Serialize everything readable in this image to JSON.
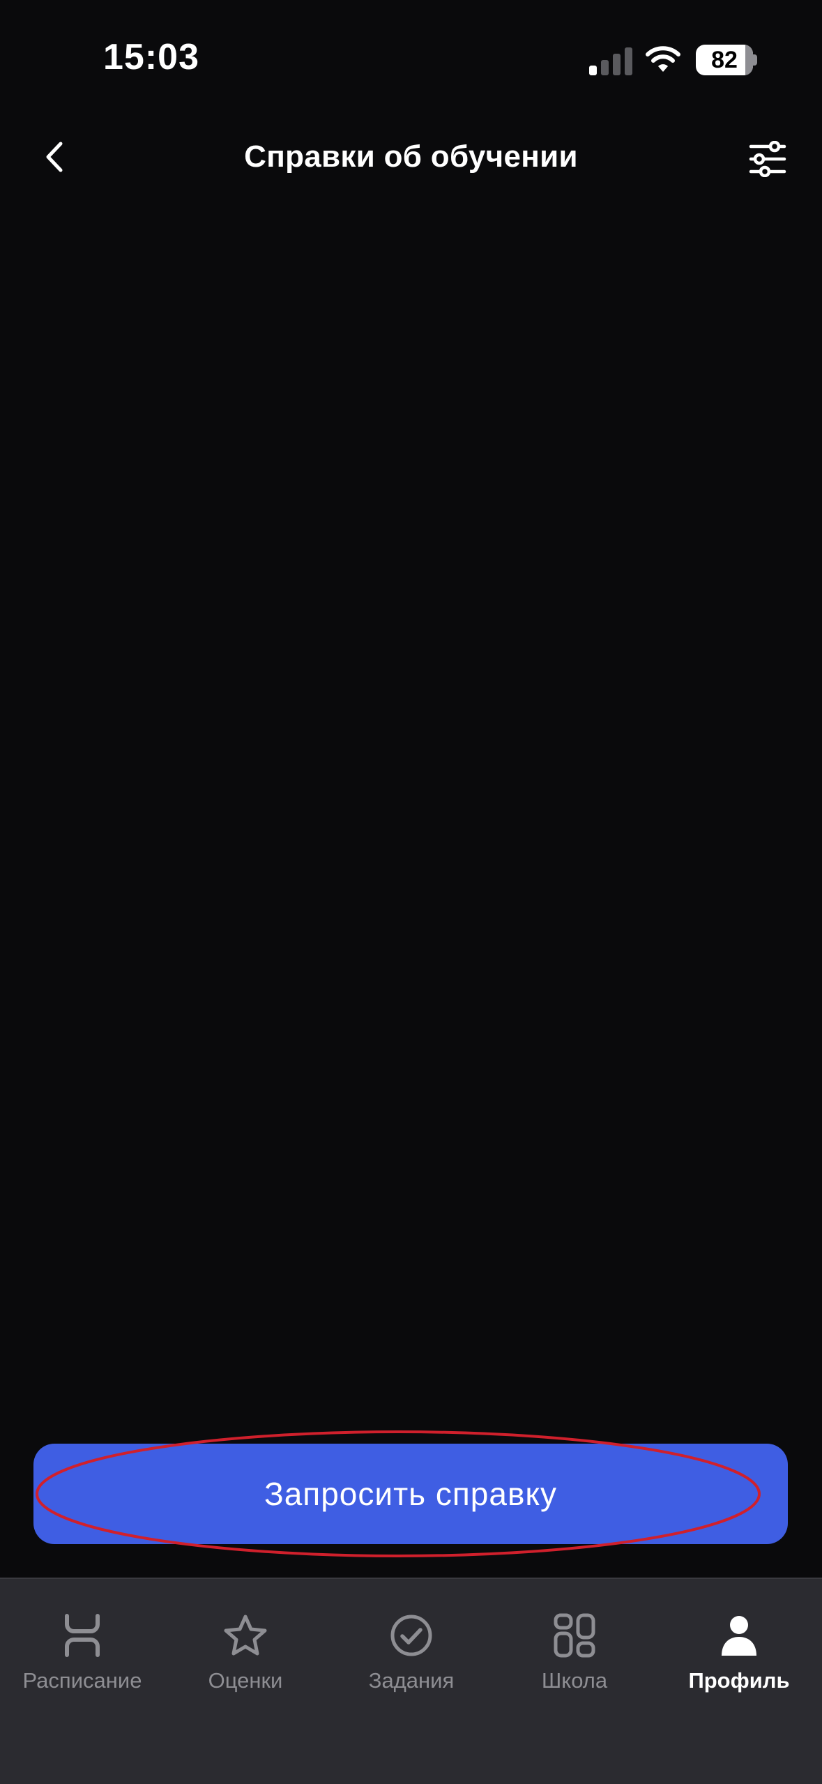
{
  "status_bar": {
    "time": "15:03",
    "battery_level": "82",
    "signal_bars_active": 1,
    "signal_bars_total": 4
  },
  "header": {
    "title": "Справки об обучении",
    "back_icon": "chevron-left-icon",
    "filter_icon": "sliders-icon"
  },
  "main": {
    "request_button_label": "Запросить справку"
  },
  "tab_bar": {
    "items": [
      {
        "label": "Расписание",
        "icon": "schedule-icon",
        "active": false
      },
      {
        "label": "Оценки",
        "icon": "star-icon",
        "active": false
      },
      {
        "label": "Задания",
        "icon": "check-circle-icon",
        "active": false
      },
      {
        "label": "Школа",
        "icon": "grid-icon",
        "active": false
      },
      {
        "label": "Профиль",
        "icon": "person-icon",
        "active": true
      }
    ]
  },
  "colors": {
    "background": "#0a0a0c",
    "accent": "#3f5ee3",
    "tab_bar": "#2b2b30",
    "inactive": "#8e8e93",
    "annotation": "#d0202c"
  }
}
